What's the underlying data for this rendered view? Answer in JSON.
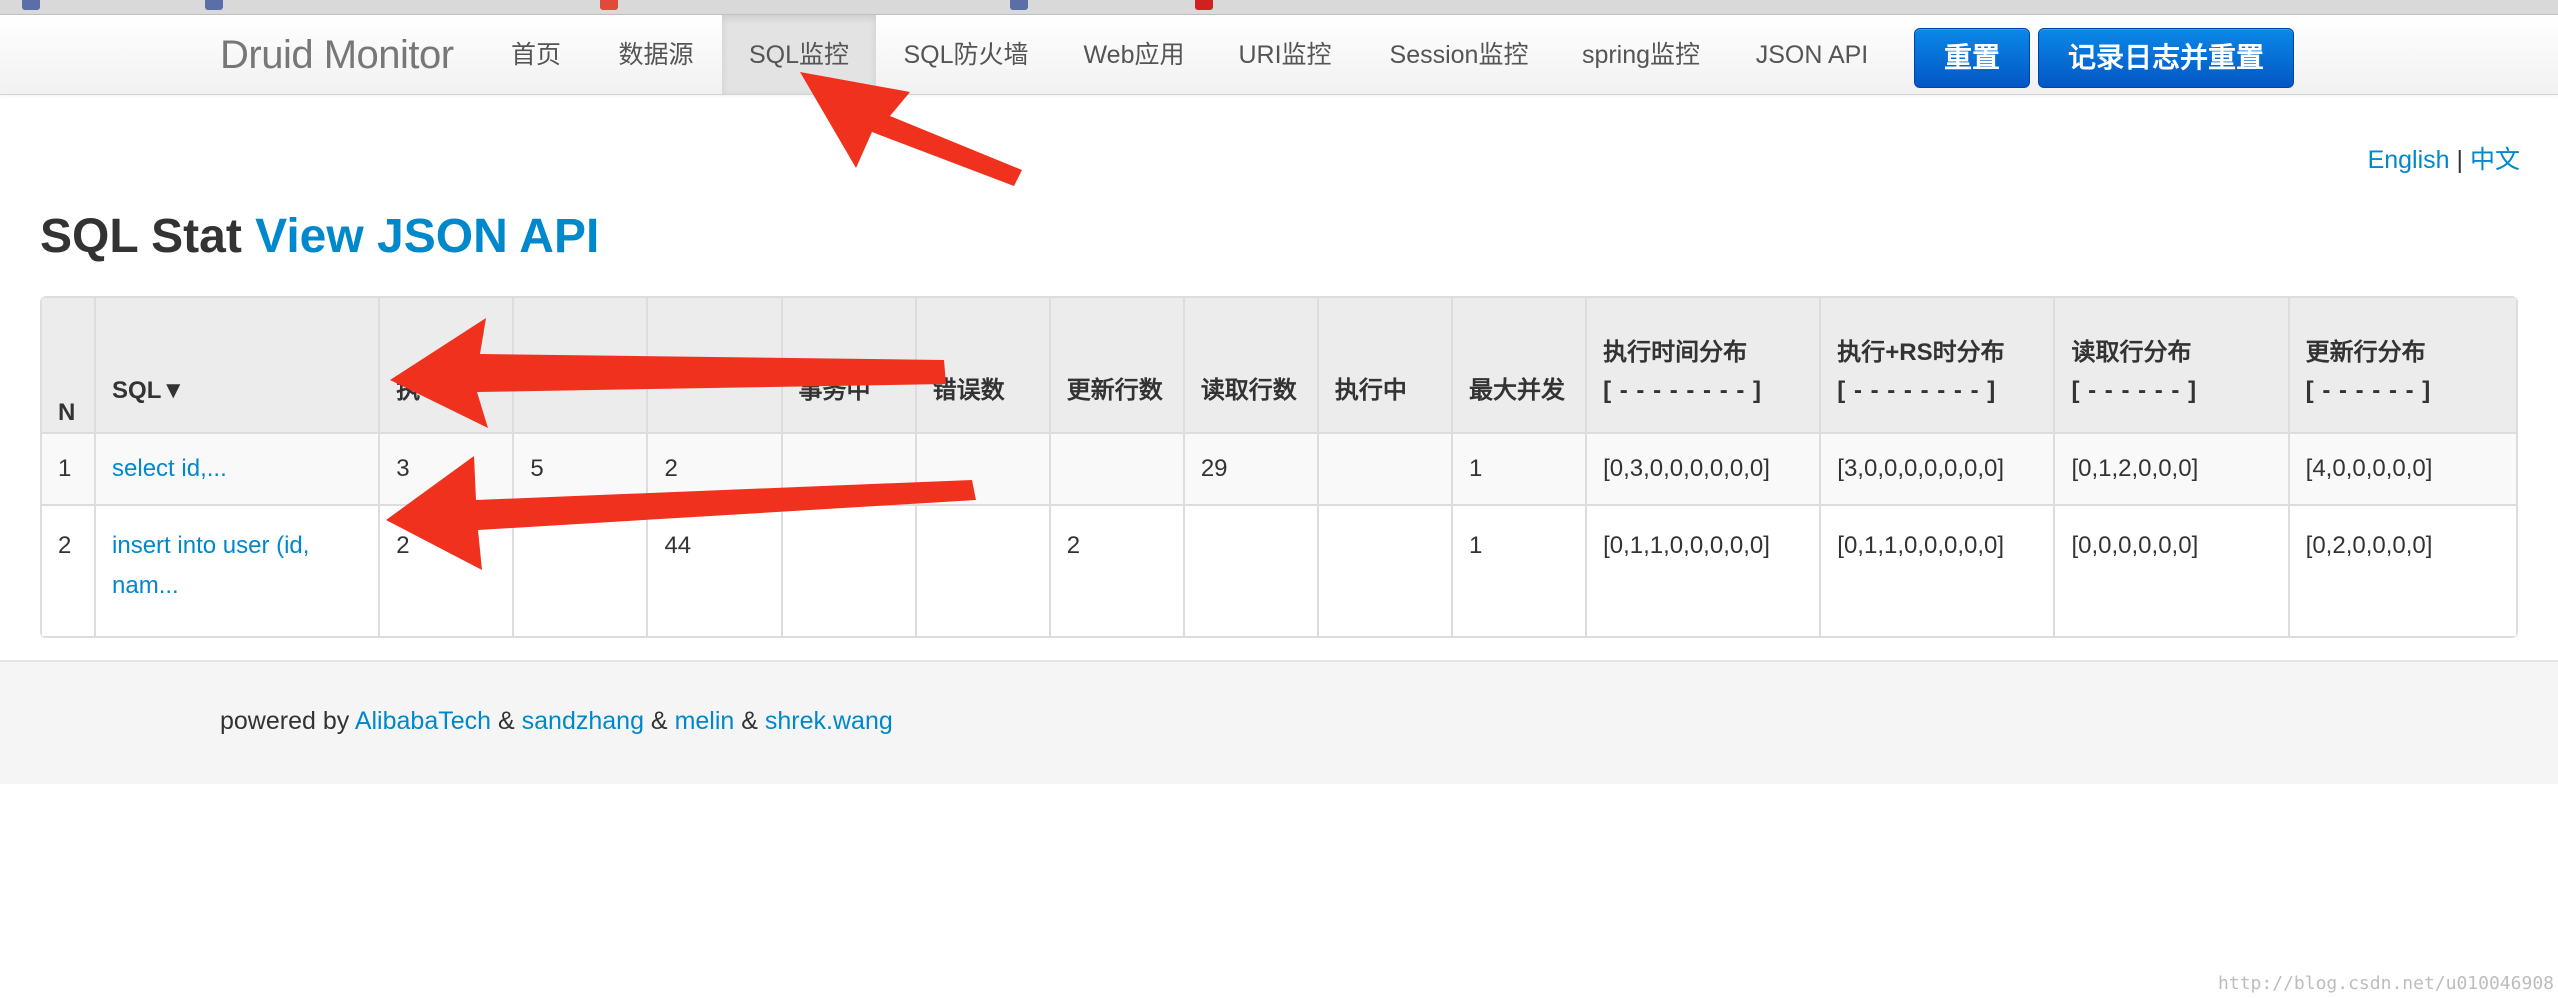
{
  "brand": "Druid Monitor",
  "nav": [
    {
      "label": "首页"
    },
    {
      "label": "数据源"
    },
    {
      "label": "SQL监控",
      "active": true
    },
    {
      "label": "SQL防火墙"
    },
    {
      "label": "Web应用"
    },
    {
      "label": "URI监控"
    },
    {
      "label": "Session监控"
    },
    {
      "label": "spring监控"
    },
    {
      "label": "JSON API"
    }
  ],
  "buttons": {
    "reset": "重置",
    "log_and_reset": "记录日志并重置"
  },
  "language": {
    "english": "English",
    "separator": "|",
    "chinese": "中文"
  },
  "title": {
    "main": "SQL Stat",
    "link": "View JSON API"
  },
  "table": {
    "headers": {
      "n": "N",
      "sql": "SQL▼",
      "exec_count": "执",
      "col4": "",
      "col5": "",
      "col6": "事务中",
      "errors": "错误数",
      "update_rows": "更新行数",
      "read_rows": "读取行数",
      "running": "执行中",
      "max_concurrent": "最大并发",
      "exec_time_dist": "执行时间分布",
      "exec_time_dist_sub": "[ - - - - - - - - ]",
      "exec_rs_dist": "执行+RS时分布",
      "exec_rs_dist_sub": "[ - - - - - - - - ]",
      "read_dist": "读取行分布",
      "read_dist_sub": "[ - - - - - - ]",
      "update_dist": "更新行分布",
      "update_dist_sub": "[ - - - - - - ]"
    },
    "rows": [
      {
        "n": "1",
        "sql": "select id,...",
        "c3": "3",
        "c4": "5",
        "c5": "2",
        "c6": "",
        "errors": "",
        "update_rows": "",
        "read_rows": "29",
        "running": "",
        "max_concurrent": "1",
        "exec_time_dist": "[0,3,0,0,0,0,0,0]",
        "exec_rs_dist": "[3,0,0,0,0,0,0,0]",
        "read_dist": "[0,1,2,0,0,0]",
        "update_dist": "[4,0,0,0,0,0]"
      },
      {
        "n": "2",
        "sql": "insert into user (id, nam...",
        "c3": "2",
        "c4": "",
        "c5": "44",
        "c6": "",
        "errors": "",
        "update_rows": "2",
        "read_rows": "",
        "running": "",
        "max_concurrent": "1",
        "exec_time_dist": "[0,1,1,0,0,0,0,0]",
        "exec_rs_dist": "[0,1,1,0,0,0,0,0]",
        "read_dist": "[0,0,0,0,0,0]",
        "update_dist": "[0,2,0,0,0,0]"
      }
    ]
  },
  "footer": {
    "powered_by": "powered by",
    "amp": "&",
    "authors": [
      "AlibabaTech",
      "sandzhang",
      "melin",
      "shrek.wang"
    ]
  },
  "watermark": "http://blog.csdn.net/u010046908",
  "colors": {
    "accent_link": "#0088cc",
    "button_blue": "#0456c4",
    "annotation_arrow": "#f0311e"
  }
}
